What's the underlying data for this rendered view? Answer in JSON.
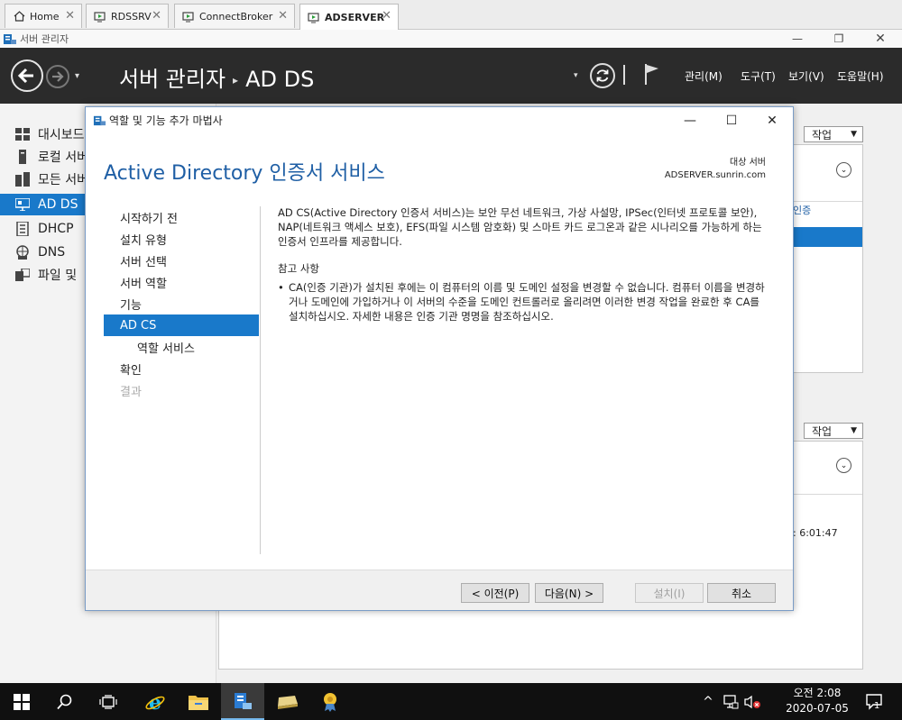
{
  "rdp_tabs": [
    {
      "label": "Home",
      "icon": "home-icon",
      "close": "✕"
    },
    {
      "label": "RDSSRV",
      "icon": "remote-desktop-icon",
      "close": "✕"
    },
    {
      "label": "ConnectBroker",
      "icon": "remote-desktop-icon",
      "close": "✕"
    },
    {
      "label": "ADSERVER",
      "icon": "remote-desktop-icon",
      "close": "✕",
      "active": true
    }
  ],
  "sm_window": {
    "title": "서버 관리자",
    "minimize": "—",
    "restore": "❐",
    "close": "✕"
  },
  "header": {
    "title_root": "서버 관리자",
    "separator": "▸",
    "title_section": "AD DS",
    "menus": [
      "관리(M)",
      "도구(T)",
      "보기(V)",
      "도움말(H)"
    ],
    "dropdown_glyph": "▾"
  },
  "leftnav": {
    "items": [
      {
        "label": "대시보드",
        "icon": "dashboard-icon"
      },
      {
        "label": "로컬 서버",
        "icon": "local-server-icon"
      },
      {
        "label": "모든 서버",
        "icon": "all-servers-icon"
      },
      {
        "label": "AD DS",
        "icon": "ad-ds-icon",
        "selected": true
      },
      {
        "label": "DHCP",
        "icon": "dhcp-icon"
      },
      {
        "label": "DNS",
        "icon": "dns-icon"
      },
      {
        "label": "파일 및",
        "icon": "file-services-icon"
      }
    ]
  },
  "background": {
    "task_label": "작업",
    "fragment_link": "인증",
    "fragment_time": "6:01:47",
    "chevron": "⌄",
    "task_arrow": "▼"
  },
  "wizard": {
    "title": "역할 및 기능 추가 마법사",
    "minimize": "—",
    "maximize": "☐",
    "close": "✕",
    "heading": "Active Directory 인증서 서비스",
    "dest_label": "대상 서버",
    "dest_server": "ADSERVER.sunrin.com",
    "steps": [
      {
        "label": "시작하기 전"
      },
      {
        "label": "설치 유형"
      },
      {
        "label": "서버 선택"
      },
      {
        "label": "서버 역할"
      },
      {
        "label": "기능"
      },
      {
        "label": "AD CS",
        "current": true
      },
      {
        "label": "역할 서비스",
        "sub": true
      },
      {
        "label": "확인"
      },
      {
        "label": "결과",
        "disabled": true
      }
    ],
    "description": "AD CS(Active Directory 인증서 서비스)는 보안 무선 네트워크, 가상 사설망, IPSec(인터넷 프로토콜 보안), NAP(네트워크 액세스 보호), EFS(파일 시스템 암호화) 및 스마트 카드 로그온과 같은 시나리오를 가능하게 하는 인증서 인프라를 제공합니다.",
    "notes_heading": "참고 사항",
    "bullet_glyph": "•",
    "note": "CA(인증 기관)가 설치된 후에는 이 컴퓨터의 이름 및 도메인 설정을 변경할 수 없습니다. 컴퓨터 이름을 변경하거나 도메인에 가입하거나 이 서버의 수준을 도메인 컨트롤러로 올리려면 이러한 변경 작업을 완료한 후 CA를 설치하십시오. 자세한 내용은 인증 기관 명명을 참조하십시오.",
    "buttons": {
      "prev": "< 이전(P)",
      "next": "다음(N) >",
      "install": "설치(I)",
      "cancel": "취소"
    }
  },
  "taskbar": {
    "items": [
      {
        "icon": "windows-start-icon"
      },
      {
        "icon": "search-icon"
      },
      {
        "icon": "task-view-icon"
      },
      {
        "icon": "internet-explorer-icon"
      },
      {
        "icon": "file-explorer-icon"
      },
      {
        "icon": "server-manager-icon",
        "active": true
      },
      {
        "icon": "drive-icon"
      },
      {
        "icon": "certificate-icon"
      }
    ],
    "clock_time": "오전 2:08",
    "clock_date": "2020-07-05",
    "notification_count": "1",
    "tray_chevron": "^"
  },
  "colors": {
    "accent": "#1979ca",
    "header_bg": "#2b2b2b",
    "heading_blue": "#1f5fa5",
    "taskbar_bg": "#101010"
  }
}
